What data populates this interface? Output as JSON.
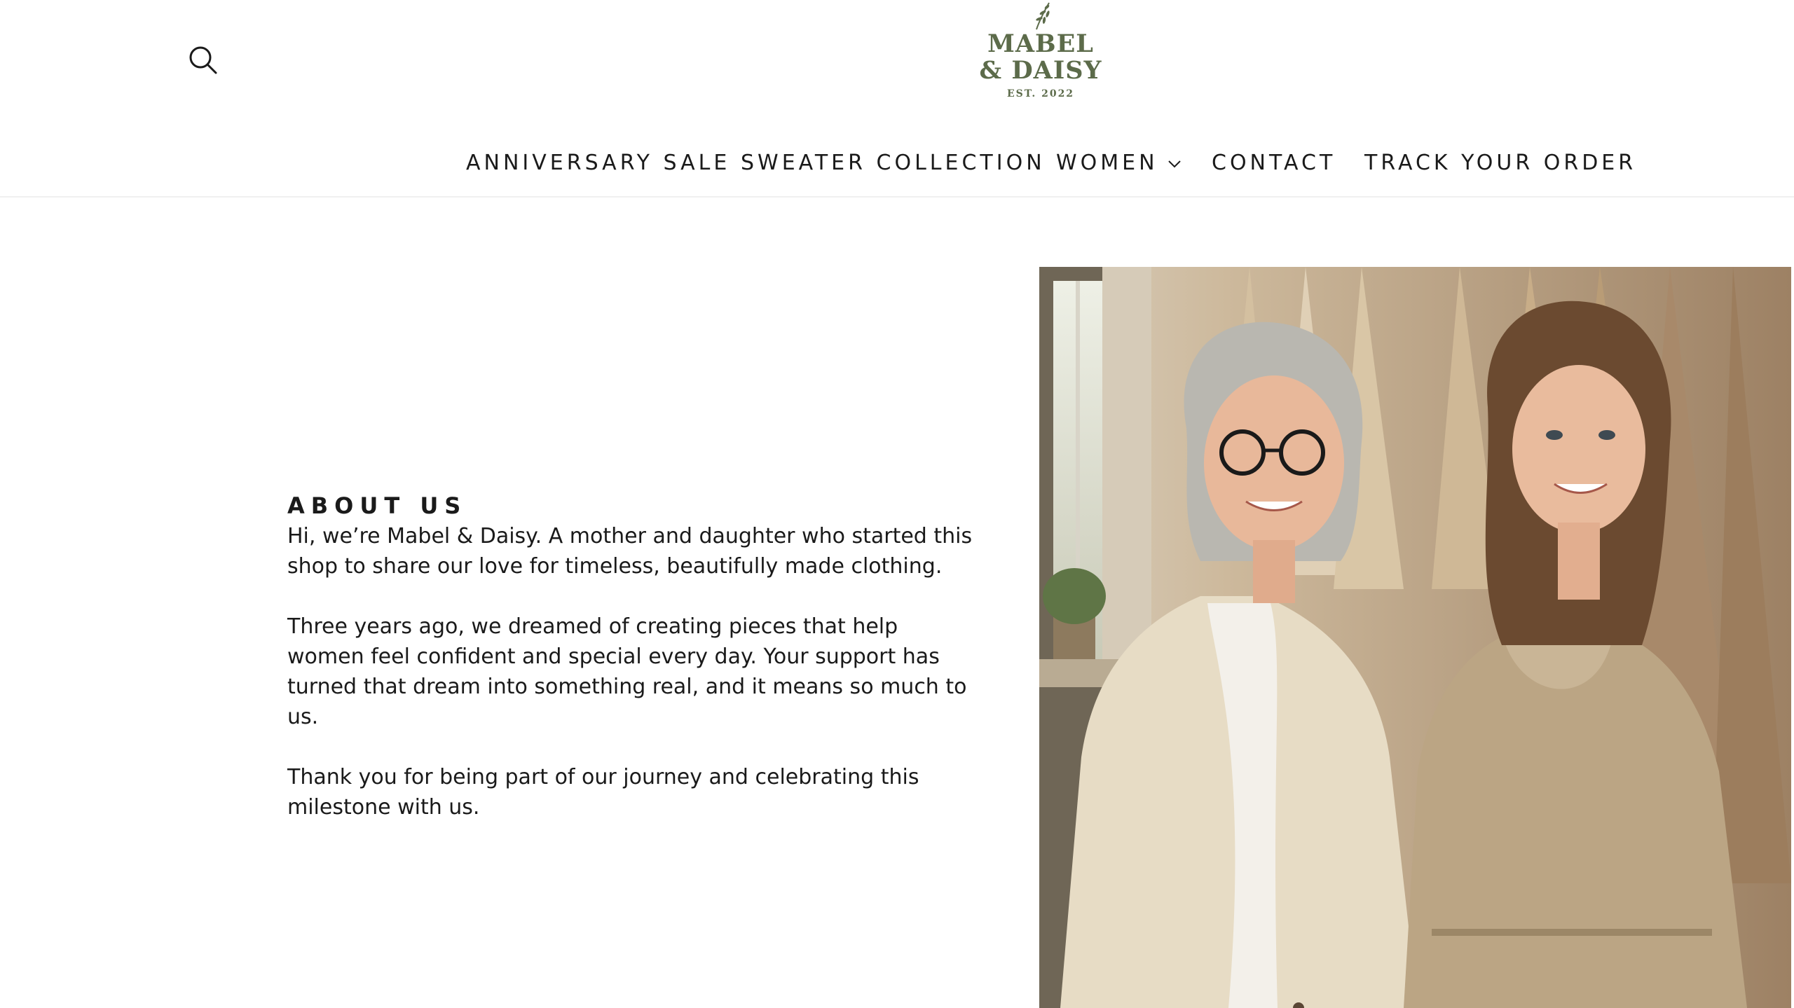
{
  "header": {
    "search_icon": "search-icon",
    "logo": {
      "line1": "MABEL",
      "line2": "& DAISY",
      "est": "EST. 2022",
      "color": "#5c6b4a"
    }
  },
  "nav": {
    "items": [
      {
        "label": "ANNIVERSARY SALE"
      },
      {
        "label": "SWEATER COLLECTION"
      },
      {
        "label": "WOMEN",
        "icon": "chevron-down-icon"
      },
      {
        "label": "CONTACT"
      },
      {
        "label": "TRACK YOUR ORDER"
      }
    ]
  },
  "about": {
    "heading": "ABOUT US",
    "paragraphs": [
      "Hi, we’re Mabel & Daisy. A mother and daughter who started this shop to share our love for timeless, beautifully made clothing.",
      "Three years ago, we dreamed of creating pieces that help women feel confident and special every day. Your support has turned that dream into something real, and it means so much to us.",
      "Thank you for being part of our journey and celebrating this milestone with us."
    ]
  }
}
